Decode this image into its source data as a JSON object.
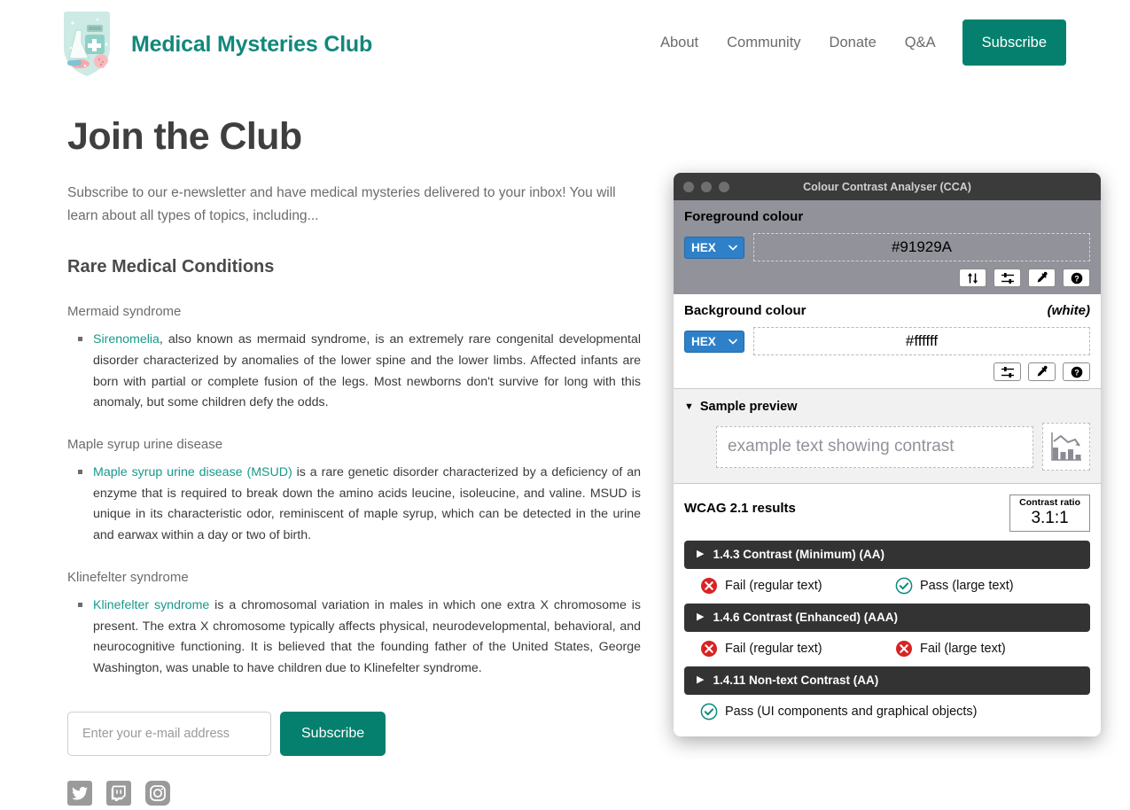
{
  "site": {
    "brand": {
      "title": "Medical Mysteries Club",
      "logo_icon": "shield-logo-icon",
      "brand_color": "#12887b"
    },
    "nav": {
      "links": [
        {
          "label": "About"
        },
        {
          "label": "Community"
        },
        {
          "label": "Donate"
        },
        {
          "label": "Q&A"
        }
      ],
      "subscribe_label": "Subscribe",
      "subscribe_color": "#05806e"
    },
    "main": {
      "page_title": "Join the Club",
      "intro": "Subscribe to our e-newsletter and have medical mysteries delivered to your inbox! You will learn about all types of topics, including...",
      "section_heading": "Rare Medical Conditions",
      "conditions": [
        {
          "title": "Mermaid syndrome",
          "link_text": "Sirenomelia",
          "body": ", also known as mermaid syndrome, is an extremely rare congenital developmental disorder characterized by anomalies of the lower spine and the lower limbs. Affected infants are born with partial or complete fusion of the legs. Most newborns don't survive for long with this anomaly, but some children defy the odds."
        },
        {
          "title": "Maple syrup urine disease",
          "link_text": "Maple syrup urine disease (MSUD)",
          "body": " is a rare genetic disorder characterized by a deficiency of an enzyme that is required to break down the amino acids leucine, isoleucine, and valine. MSUD is unique in its characteristic odor, reminiscent of maple syrup, which can be detected in the urine and earwax within a day or two of birth."
        },
        {
          "title": "Klinefelter syndrome",
          "link_text": "Klinefelter syndrome",
          "body": " is a chromosomal variation in males in which one extra X chromosome is present. The extra X chromosome typically affects physical, neurodevelopmental, behavioral, and neurocognitive functioning. It is believed that the founding father of the United States, George Washington, was unable to have children due to Klinefelter syndrome."
        }
      ]
    },
    "subscribe_form": {
      "email_placeholder": "Enter your e-mail address",
      "email_value": "",
      "button_label": "Subscribe"
    },
    "social": [
      {
        "name": "twitter-icon"
      },
      {
        "name": "twitch-icon"
      },
      {
        "name": "instagram-icon"
      }
    ]
  },
  "cca": {
    "window_title": "Colour Contrast Analyser (CCA)",
    "foreground": {
      "label": "Foreground colour",
      "format": "HEX",
      "value": "#91929A",
      "buttons": [
        "swap-colours-icon",
        "sliders-icon",
        "eyedropper-icon",
        "help-icon"
      ]
    },
    "background": {
      "label": "Background colour",
      "note": "(white)",
      "format": "HEX",
      "value": "#ffffff",
      "buttons": [
        "sliders-icon",
        "eyedropper-icon",
        "help-icon"
      ]
    },
    "preview": {
      "label": "Sample preview",
      "disclosure": "▼",
      "sample_text": "example text showing contrast",
      "chart_icon": "bar-chart-declining-icon"
    },
    "results": {
      "title": "WCAG 2.1 results",
      "contrast_ratio_label": "Contrast ratio",
      "contrast_ratio_value": "3.1:1",
      "criteria": [
        {
          "arrow": "▶",
          "name": "1.4.3 Contrast (Minimum) (AA)",
          "outcomes": [
            {
              "status": "fail",
              "text": "Fail (regular text)"
            },
            {
              "status": "pass",
              "text": "Pass (large text)"
            }
          ]
        },
        {
          "arrow": "▶",
          "name": "1.4.6 Contrast (Enhanced) (AAA)",
          "outcomes": [
            {
              "status": "fail",
              "text": "Fail (regular text)"
            },
            {
              "status": "fail",
              "text": "Fail (large text)"
            }
          ]
        },
        {
          "arrow": "▶",
          "name": "1.4.11 Non-text Contrast (AA)",
          "outcomes": [
            {
              "status": "pass",
              "text": "Pass (UI components and graphical objects)"
            }
          ]
        }
      ]
    },
    "colors": {
      "fail": "#d92323",
      "pass": "#0f8a7e",
      "titlebar": "#3b3b3b",
      "bar": "#333333"
    }
  }
}
